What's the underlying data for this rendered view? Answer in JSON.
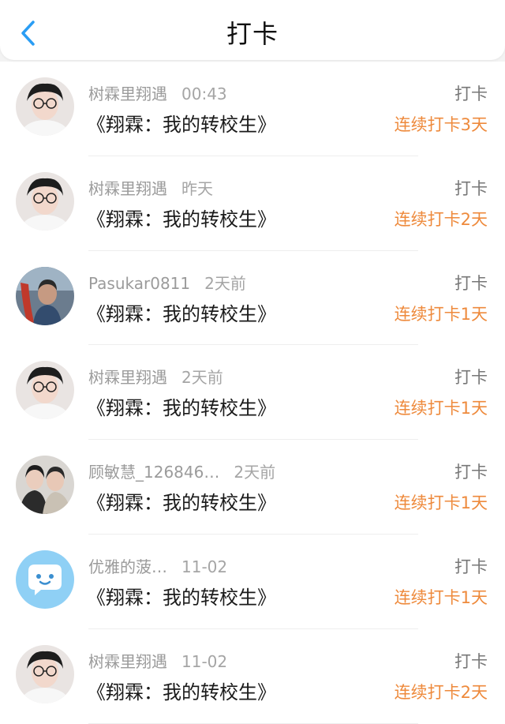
{
  "header": {
    "title": "打卡",
    "back_icon": "chevron-left-icon",
    "accent": "#2a9df4"
  },
  "colors": {
    "streak": "#ee8a3c"
  },
  "items": [
    {
      "user": "树霖里翔遇",
      "time": "00:43",
      "book": "《翔霖：我的转校生》",
      "action": "打卡",
      "streak": "连续打卡3天",
      "avatar": "boy-selfie"
    },
    {
      "user": "树霖里翔遇",
      "time": "昨天",
      "book": "《翔霖：我的转校生》",
      "action": "打卡",
      "streak": "连续打卡2天",
      "avatar": "boy-selfie"
    },
    {
      "user": "Pasukar0811",
      "time": "2天前",
      "book": "《翔霖：我的转校生》",
      "action": "打卡",
      "streak": "连续打卡1天",
      "avatar": "child-photo"
    },
    {
      "user": "树霖里翔遇",
      "time": "2天前",
      "book": "《翔霖：我的转校生》",
      "action": "打卡",
      "streak": "连续打卡1天",
      "avatar": "boy-selfie"
    },
    {
      "user": "顾敏慧_126846…",
      "time": "2天前",
      "book": "《翔霖：我的转校生》",
      "action": "打卡",
      "streak": "连续打卡1天",
      "avatar": "two-boys"
    },
    {
      "user": "优雅的菠…",
      "time": "11-02",
      "book": "《翔霖：我的转校生》",
      "action": "打卡",
      "streak": "连续打卡1天",
      "avatar": "chat-bubble"
    },
    {
      "user": "树霖里翔遇",
      "time": "11-02",
      "book": "《翔霖：我的转校生》",
      "action": "打卡",
      "streak": "连续打卡2天",
      "avatar": "boy-selfie"
    }
  ]
}
